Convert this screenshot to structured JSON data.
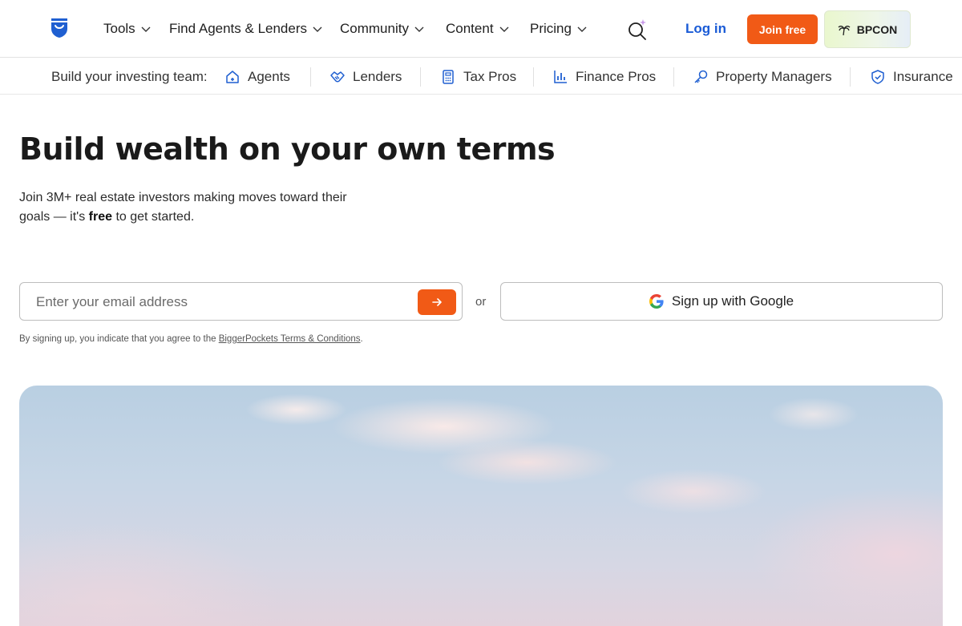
{
  "nav": {
    "items": [
      {
        "label": "Tools"
      },
      {
        "label": "Find Agents & Lenders"
      },
      {
        "label": "Community"
      },
      {
        "label": "Content"
      },
      {
        "label": "Pricing"
      }
    ],
    "login_label": "Log in",
    "join_label": "Join free",
    "bpcon_label": "BPCON"
  },
  "team_bar": {
    "label": "Build your investing team:",
    "items": [
      {
        "label": "Agents",
        "icon": "house-icon"
      },
      {
        "label": "Lenders",
        "icon": "handshake-icon"
      },
      {
        "label": "Tax Pros",
        "icon": "calculator-icon"
      },
      {
        "label": "Finance Pros",
        "icon": "bar-chart-icon"
      },
      {
        "label": "Property Managers",
        "icon": "key-icon"
      },
      {
        "label": "Insurance",
        "icon": "shield-icon"
      }
    ]
  },
  "hero": {
    "title": "Build wealth on your own terms",
    "subtitle_part1": "Join 3M+ real estate investors making moves toward their goals — it's ",
    "subtitle_bold": "free",
    "subtitle_part2": " to get started.",
    "email_placeholder": "Enter your email address",
    "or_label": "or",
    "google_label": "Sign up with Google",
    "terms_prefix": "By signing up, you indicate that you agree to the ",
    "terms_link": "BiggerPockets Terms & Conditions",
    "terms_suffix": "."
  },
  "colors": {
    "accent": "#f15a16",
    "link": "#1a5bd6",
    "brand": "#1f5fd1"
  }
}
